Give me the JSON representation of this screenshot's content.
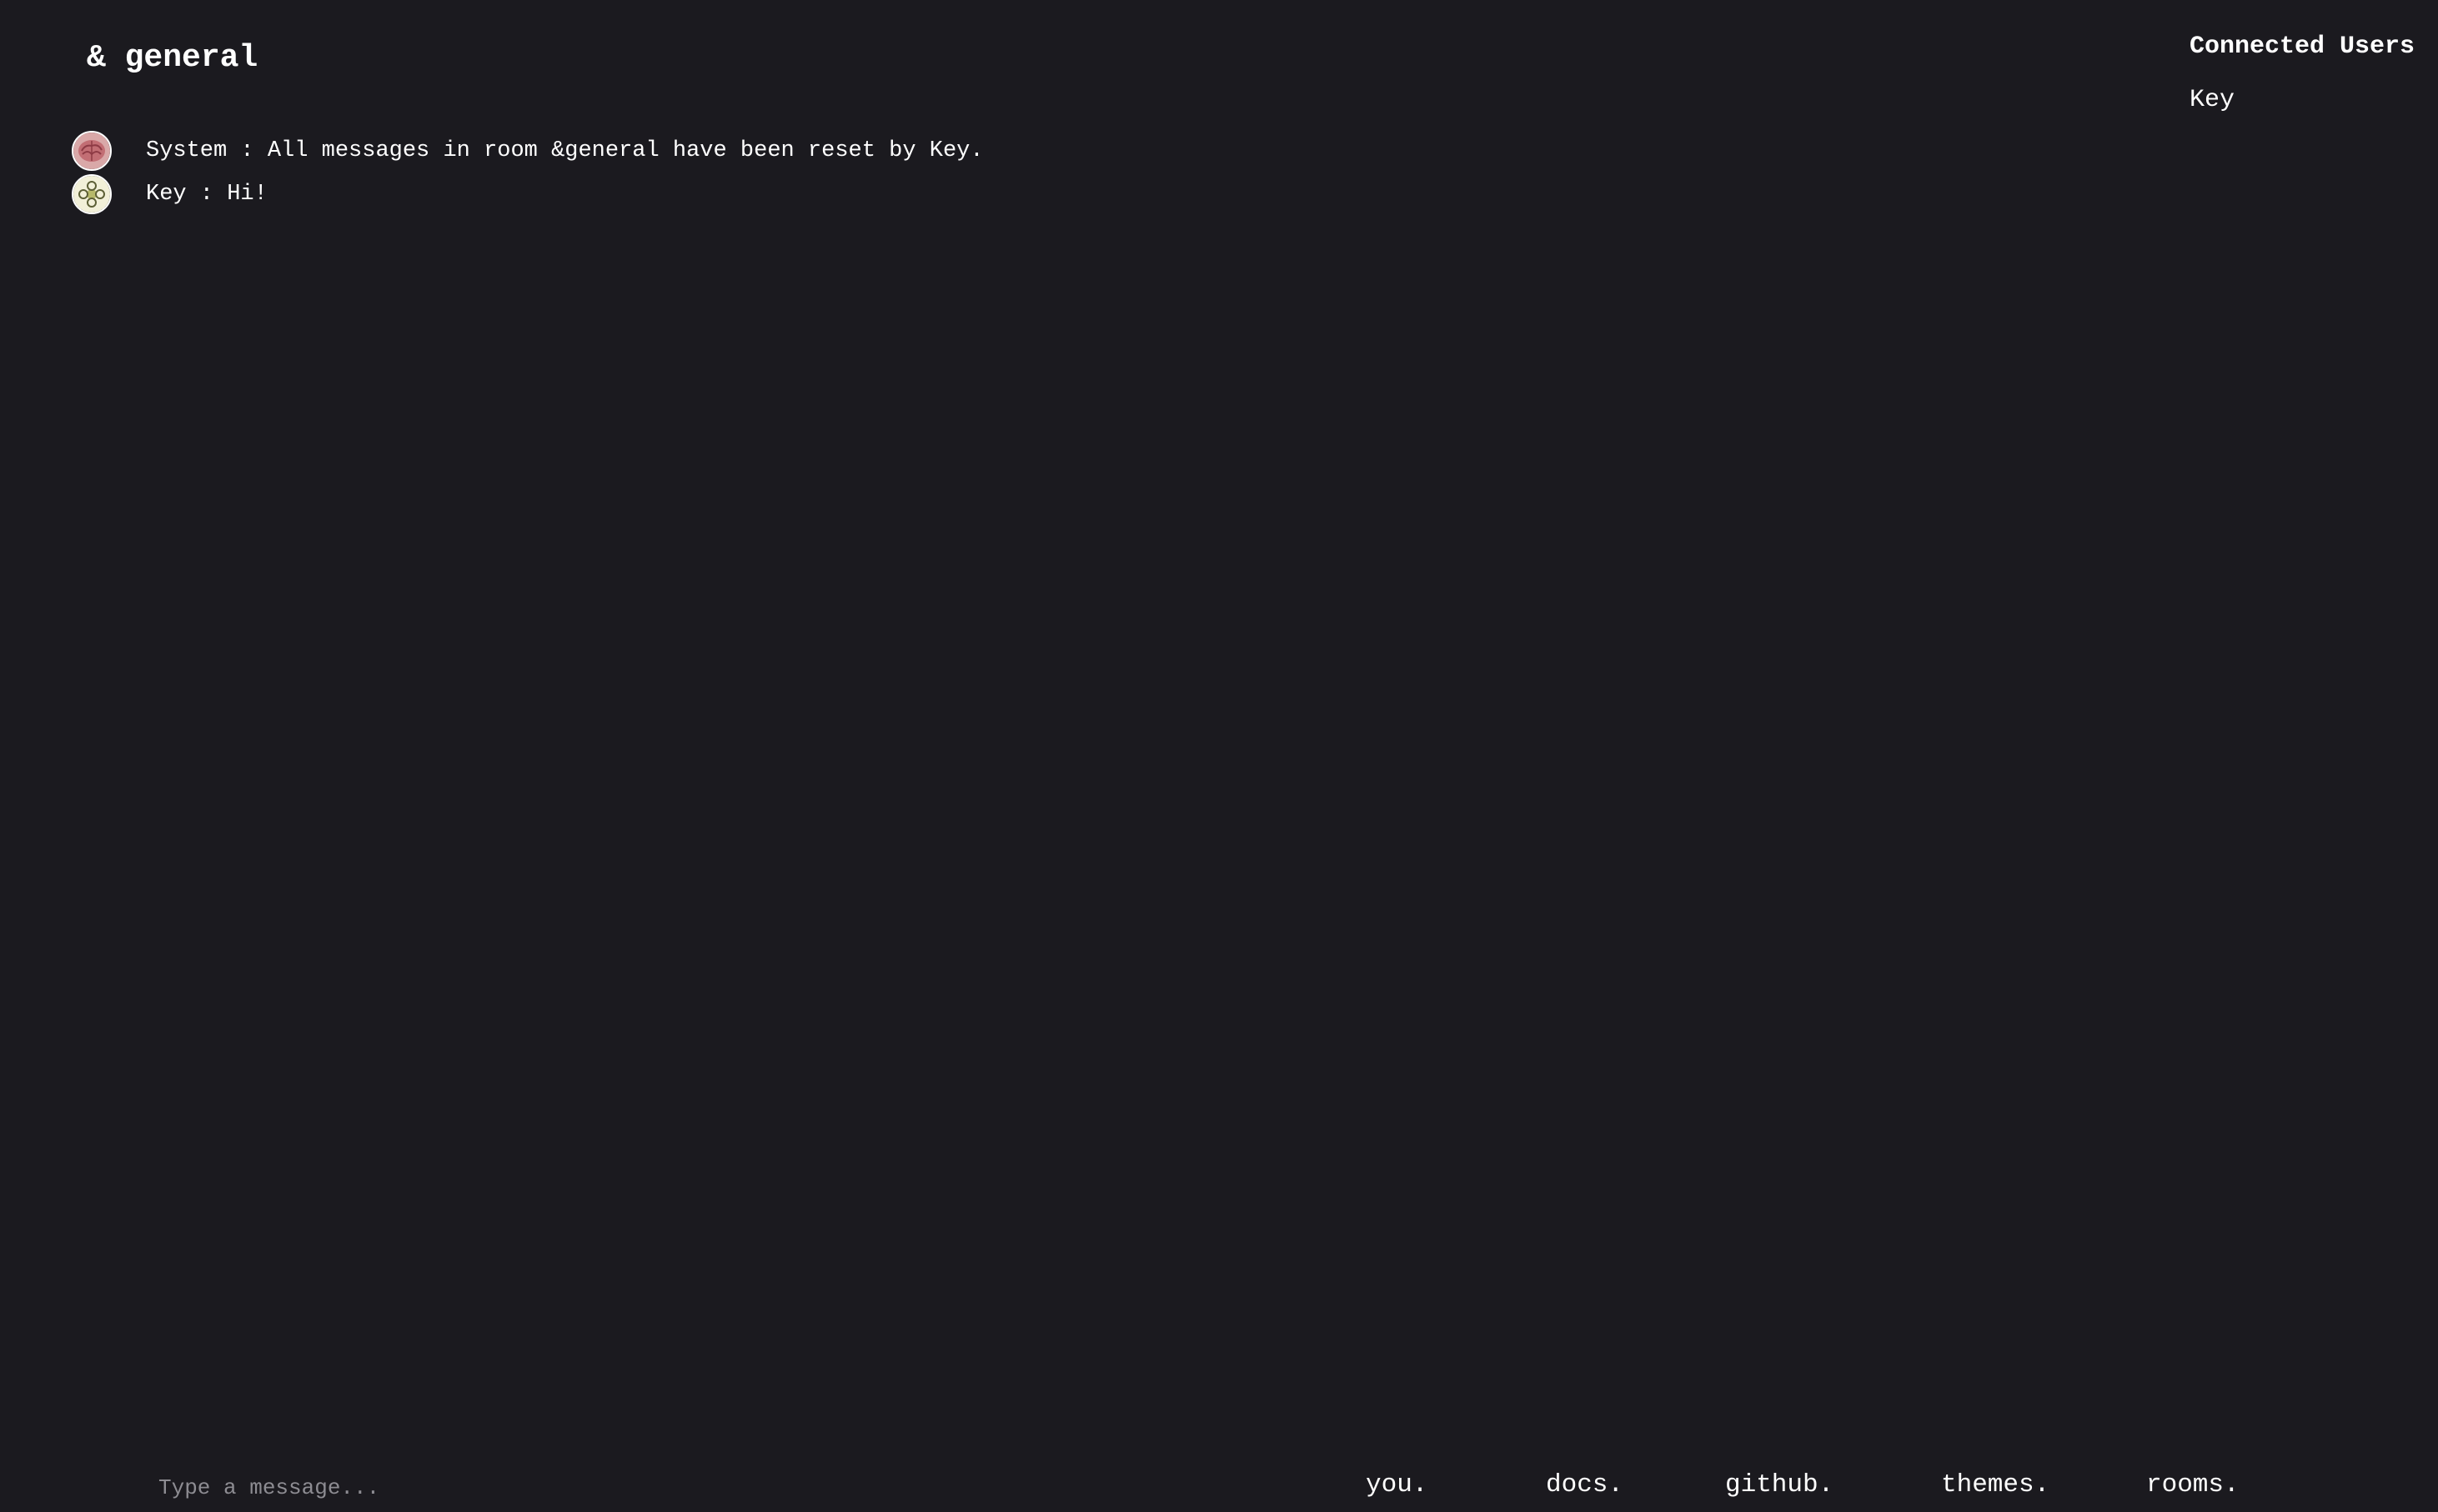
{
  "room": {
    "title": "& general"
  },
  "messages": [
    {
      "sender": "System",
      "text": "All messages in room &general have been reset by Key.",
      "line": "System : All messages in room &general have been reset by Key.",
      "avatar_icon": "brain-icon"
    },
    {
      "sender": "Key",
      "text": "Hi!",
      "line": "Key : Hi!",
      "avatar_icon": "key-avatar-icon"
    }
  ],
  "sidebar": {
    "title": "Connected Users",
    "users": [
      "Key"
    ]
  },
  "composer": {
    "placeholder": "Type a message...",
    "value": ""
  },
  "nav": {
    "you": "you.",
    "docs": "docs.",
    "github": "github.",
    "themes": "themes.",
    "rooms": "rooms."
  },
  "colors": {
    "background": "#1b1a1f",
    "text": "#ffffff",
    "placeholder": "#8d8c92"
  }
}
